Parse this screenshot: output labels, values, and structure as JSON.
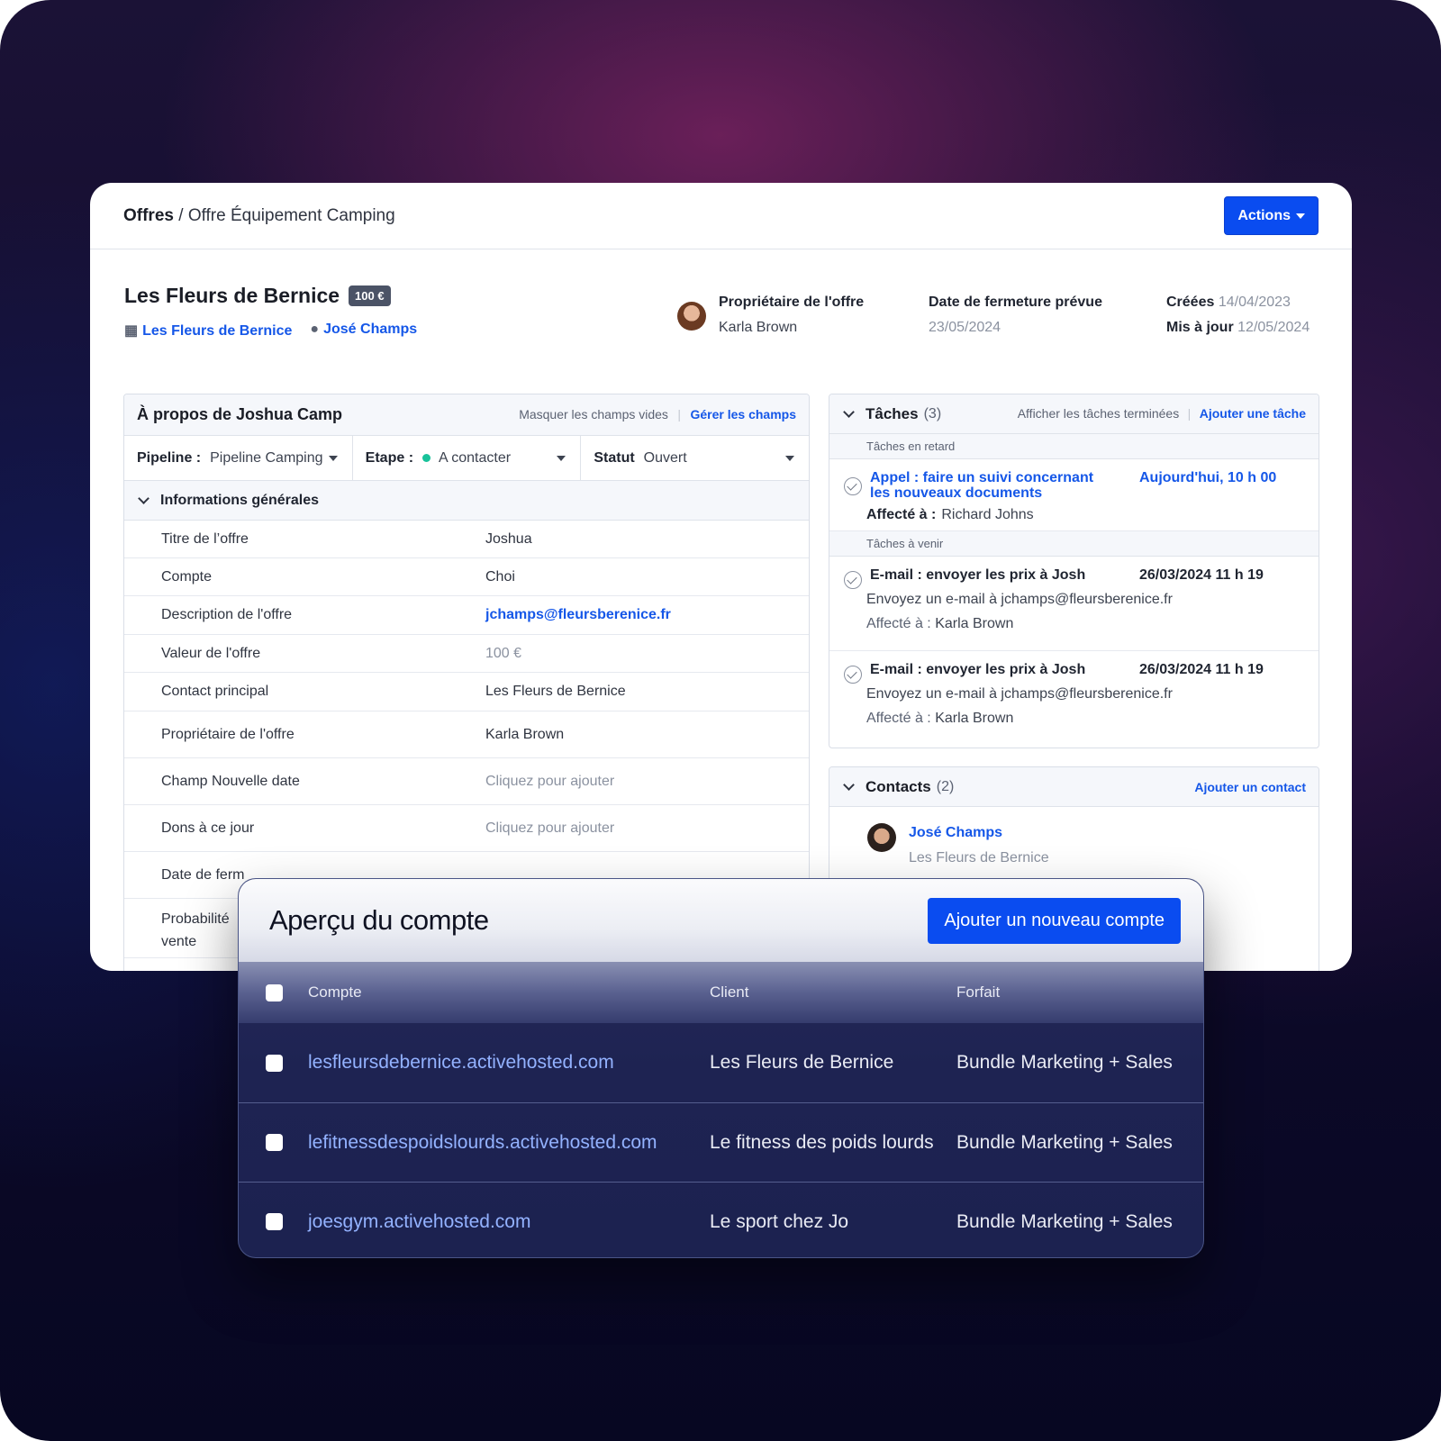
{
  "breadcrumb": {
    "root": "Offres",
    "separator": "/",
    "current": "Offre Équipement Camping"
  },
  "actions_label": "Actions",
  "deal": {
    "title": "Les Fleurs de Bernice",
    "amount": "100 €",
    "account_link": "Les Fleurs de Bernice",
    "contact_link": "José Champs",
    "owner_label": "Propriétaire de l'offre",
    "owner": "Karla Brown",
    "close_label": "Date de fermeture prévue",
    "close_date": "23/05/2024",
    "created_label": "Créées",
    "created": "14/04/2023",
    "updated_label": "Mis à jour",
    "updated": "12/05/2024"
  },
  "about": {
    "title": "À propos de Joshua Camp",
    "hide_empty": "Masquer les champs vides",
    "manage_fields": "Gérer les champs",
    "pipeline_label": "Pipeline :",
    "pipeline_value": "Pipeline Camping",
    "stage_label": "Etape :",
    "stage_value": "A contacter",
    "status_label": "Statut",
    "status_value": "Ouvert",
    "section": "Informations générales",
    "fields": [
      {
        "k": "Titre de l’offre",
        "v": "Joshua"
      },
      {
        "k": "Compte",
        "v": "Choi"
      },
      {
        "k": "Description de l'offre",
        "v": "jchamps@fleursberenice.fr"
      },
      {
        "k": "Valeur de l'offre",
        "v": "100 €"
      },
      {
        "k": "Contact principal",
        "v": "Les Fleurs de Bernice"
      },
      {
        "k": "Propriétaire de l'offre",
        "v": "Karla Brown"
      },
      {
        "k": "Champ Nouvelle date",
        "v": "Cliquez pour ajouter"
      },
      {
        "k": "Dons à ce jour",
        "v": "Cliquez pour ajouter"
      },
      {
        "k": "Date de ferm",
        "v": ""
      },
      {
        "k": "Probabilité",
        "k2": "vente",
        "v": ""
      }
    ]
  },
  "tasks": {
    "title": "Tâches",
    "count": "(3)",
    "show_done": "Afficher les tâches terminées",
    "add": "Ajouter une tâche",
    "overdue_label": "Tâches en retard",
    "upcoming_label": "Tâches à venir",
    "assigned_label": "Affecté à :",
    "items": [
      {
        "title1": "Appel : faire un suivi concernant",
        "title2": "les nouveaux documents",
        "when": "Aujourd'hui, 10 h 00",
        "assignee": "Richard Johns"
      },
      {
        "title1": "E-mail : envoyer les prix à Josh",
        "when": "26/03/2024 11 h 19",
        "desc": "Envoyez un e-mail à jchamps@fleursberenice.fr",
        "assignee": "Karla Brown"
      },
      {
        "title1": "E-mail : envoyer les prix à Josh",
        "when": "26/03/2024 11 h 19",
        "desc": "Envoyez un e-mail à jchamps@fleursberenice.fr",
        "assignee": "Karla Brown"
      }
    ]
  },
  "contacts": {
    "title": "Contacts",
    "count": "(2)",
    "add": "Ajouter un contact",
    "items": [
      {
        "name": "José Champs",
        "org": "Les Fleurs de Bernice"
      }
    ]
  },
  "overview": {
    "title": "Aperçu du compte",
    "add_button": "Ajouter un nouveau compte",
    "headers": {
      "account": "Compte",
      "client": "Client",
      "plan": "Forfait"
    },
    "rows": [
      {
        "account": "lesfleursdebernice.activehosted.com",
        "client": "Les Fleurs de Bernice",
        "plan": "Bundle Marketing + Sales"
      },
      {
        "account": "lefitnessdespoidslourds.activehosted.com",
        "client": "Le fitness des poids lourds",
        "plan": "Bundle Marketing + Sales"
      },
      {
        "account": "joesgym.activehosted.com",
        "client": "Le sport chez Jo",
        "plan": "Bundle Marketing + Sales"
      }
    ]
  },
  "colors": {
    "accent": "#0a4cf0",
    "link": "#1557e8",
    "stage_dot": "#18c29a"
  }
}
